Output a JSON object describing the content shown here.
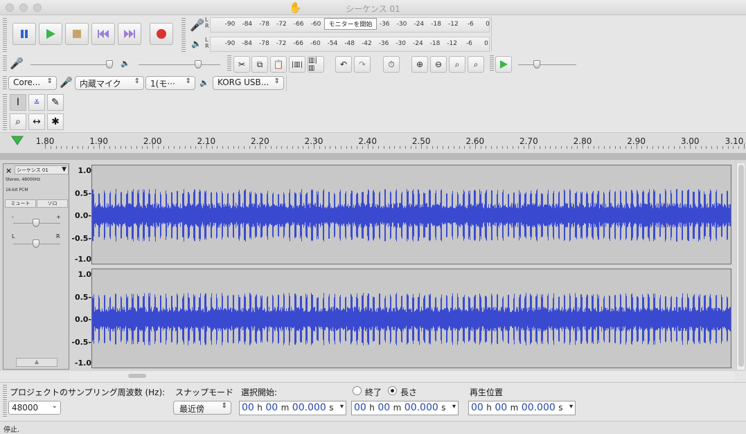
{
  "window": {
    "title": "シーケンス 01"
  },
  "meters": {
    "record_ticks": [
      "-90",
      "-84",
      "-78",
      "-72",
      "-66",
      "-60",
      "-36",
      "-30",
      "-24",
      "-18",
      "-12",
      "-6",
      "0"
    ],
    "play_ticks": [
      "-90",
      "-84",
      "-78",
      "-72",
      "-66",
      "-60",
      "-54",
      "-48",
      "-42",
      "-36",
      "-30",
      "-24",
      "-18",
      "-12",
      "-6",
      "0"
    ],
    "channel_l": "L",
    "channel_r": "R",
    "monitor_label": "モニターを開始"
  },
  "devices": {
    "host": "Core...",
    "input": "内蔵マイク",
    "channels": "1(モ···",
    "output": "KORG USB..."
  },
  "ruler": {
    "labels": [
      "1.80",
      "1.90",
      "2.00",
      "2.10",
      "2.20",
      "2.30",
      "2.40",
      "2.50",
      "2.60",
      "2.70",
      "2.80",
      "2.90",
      "3.00",
      "3.10"
    ]
  },
  "track": {
    "name": "シーケンス 01",
    "info1": "Stereo, 48000Hz",
    "info2": "16-bit PCM",
    "mute": "ミュート",
    "solo": "ソロ",
    "gain_minus": "-",
    "gain_plus": "+",
    "pan_l": "L",
    "pan_r": "R",
    "scale": [
      "1.0",
      "0.5-",
      "0.0-",
      "-0.5-",
      "-1.0"
    ],
    "wave_color": "#3a4ad0"
  },
  "selection": {
    "rate_label": "プロジェクトのサンプリング周波数 (Hz):",
    "rate_value": "48000",
    "snap_label": "スナップモード",
    "snap_value": "最近傍",
    "start_label": "選択開始:",
    "end_label": "終了",
    "length_label": "長さ",
    "position_label": "再生位置",
    "time_h": "00",
    "time_m": "00",
    "time_s": "00.000"
  },
  "status": {
    "text": "停止."
  }
}
